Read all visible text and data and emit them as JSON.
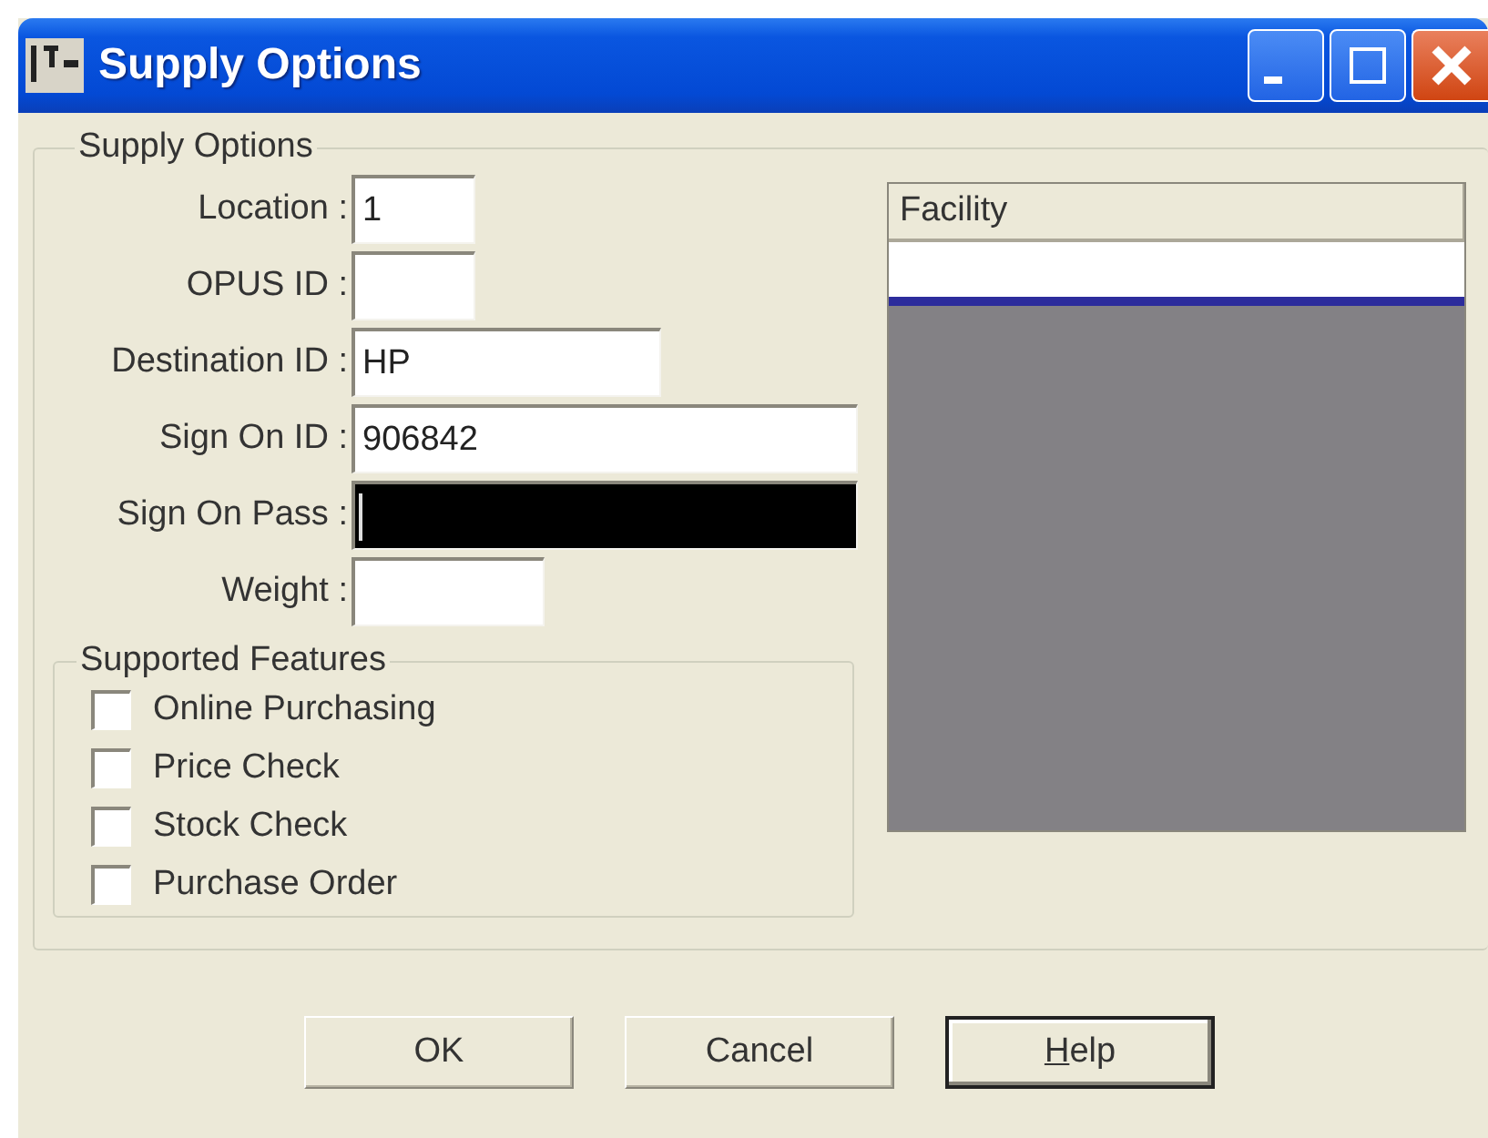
{
  "window": {
    "title": "Supply Options"
  },
  "group": {
    "title": "Supply Options"
  },
  "fields": [
    {
      "label": "Location :",
      "value": "1",
      "kind": "text"
    },
    {
      "label": "OPUS ID :",
      "kind": "text"
    },
    {
      "label": "Destination ID :",
      "value": "HP",
      "kind": "text"
    },
    {
      "label": "Sign On ID :",
      "value": "906842",
      "kind": "text"
    },
    {
      "label": "Sign On Pass :",
      "kind": "password"
    },
    {
      "label": "Weight :",
      "kind": "text"
    }
  ],
  "features": {
    "title": "Supported Features",
    "items": [
      {
        "label": "Online Purchasing",
        "checked": false
      },
      {
        "label": "Price Check",
        "checked": false
      },
      {
        "label": "Stock Check",
        "checked": false
      },
      {
        "label": "Purchase Order",
        "checked": false
      }
    ]
  },
  "list": {
    "columns": [
      "Facility"
    ]
  },
  "buttons": [
    {
      "label": "OK",
      "default": false,
      "mnemonic": false
    },
    {
      "label": "Cancel",
      "default": false,
      "mnemonic": false
    },
    {
      "label": "Help",
      "default": true,
      "mnemonic": true
    }
  ]
}
